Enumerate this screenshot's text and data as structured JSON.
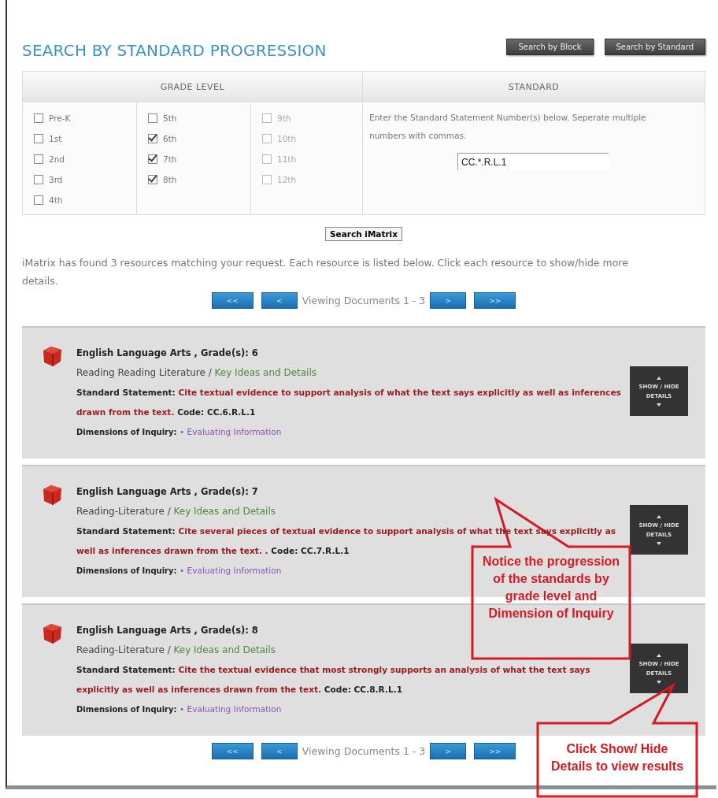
{
  "title": "SEARCH BY STANDARD PROGRESSION",
  "header_buttons": [
    "Search by Block",
    "Search by Standard"
  ],
  "grade_level": {
    "heading": "GRADE LEVEL",
    "columns": [
      [
        {
          "label": "Pre-K",
          "checked": false,
          "disabled": false
        },
        {
          "label": "1st",
          "checked": false,
          "disabled": false
        },
        {
          "label": "2nd",
          "checked": false,
          "disabled": false
        },
        {
          "label": "3rd",
          "checked": false,
          "disabled": false
        },
        {
          "label": "4th",
          "checked": false,
          "disabled": false
        }
      ],
      [
        {
          "label": "5th",
          "checked": false,
          "disabled": false
        },
        {
          "label": "6th",
          "checked": true,
          "disabled": false
        },
        {
          "label": "7th",
          "checked": true,
          "disabled": false
        },
        {
          "label": "8th",
          "checked": true,
          "disabled": false
        }
      ],
      [
        {
          "label": "9th",
          "checked": false,
          "disabled": true
        },
        {
          "label": "10th",
          "checked": false,
          "disabled": true
        },
        {
          "label": "11th",
          "checked": false,
          "disabled": true
        },
        {
          "label": "12th",
          "checked": false,
          "disabled": true
        }
      ]
    ]
  },
  "standard": {
    "heading": "STANDARD",
    "instructions": "Enter the Standard Statement Number(s) below. Seperate multiple numbers with commas.",
    "value": "CC.*.R.L.1"
  },
  "search_button": "Search iMatrix",
  "result_message": "iMatrix has found 3 resources matching your request. Each resource is listed below. Click each resource to show/hide more details.",
  "pager_top": {
    "first": "<<",
    "prev": "<",
    "status": "Viewing Documents 1 - 3",
    "next": ">",
    "last": ">>"
  },
  "results": [
    {
      "title": "English Language Arts , Grade(s): 6",
      "strand": "Reading Reading Literature",
      "separator": "/",
      "cluster": "Key Ideas and Details",
      "statement_label": "Standard Statement:",
      "statement": "Cite textual evidence to support analysis of what the text says explicitly as well as inferences drawn from the text.",
      "code_label": "Code:",
      "code": "CC.6.R.L.1",
      "dimensions_label": "Dimensions of Inquiry:",
      "dimension": "• Evaluating Information",
      "toggle": "SHOW / HIDE DETAILS"
    },
    {
      "title": "English Language Arts , Grade(s): 7",
      "strand": "Reading-Literature",
      "separator": "/",
      "cluster": "Key Ideas and Details",
      "statement_label": "Standard Statement:",
      "statement": "Cite several pieces of textual evidence to support analysis of what the text says explicitly as well as inferences drawn from the text. .",
      "code_label": "Code:",
      "code": "CC.7.R.L.1",
      "dimensions_label": "Dimensions of Inquiry:",
      "dimension": "• Evaluating Information",
      "toggle": "SHOW / HIDE DETAILS"
    },
    {
      "title": "English Language Arts , Grade(s): 8",
      "strand": "Reading-Literature",
      "separator": "/",
      "cluster": "Key Ideas and Details",
      "statement_label": "Standard Statement:",
      "statement": "Cite the textual evidence that most strongly supports an analysis of what the text says explicitly as well as inferences drawn from the text.",
      "code_label": "Code:",
      "code": "CC.8.R.L.1",
      "dimensions_label": "Dimensions of Inquiry:",
      "dimension": "• Evaluating Information",
      "toggle": "SHOW / HIDE DETAILS"
    }
  ],
  "pager_bottom": {
    "first": "<<",
    "prev": "<",
    "status": "Viewing Documents 1 - 3",
    "next": ">",
    "last": ">>"
  },
  "callouts": [
    {
      "kind": "up-left",
      "text": "Notice the progression of the standards by grade level and Dimension of Inquiry"
    },
    {
      "kind": "up-right",
      "text": "Click Show/ Hide Details to view results"
    }
  ]
}
